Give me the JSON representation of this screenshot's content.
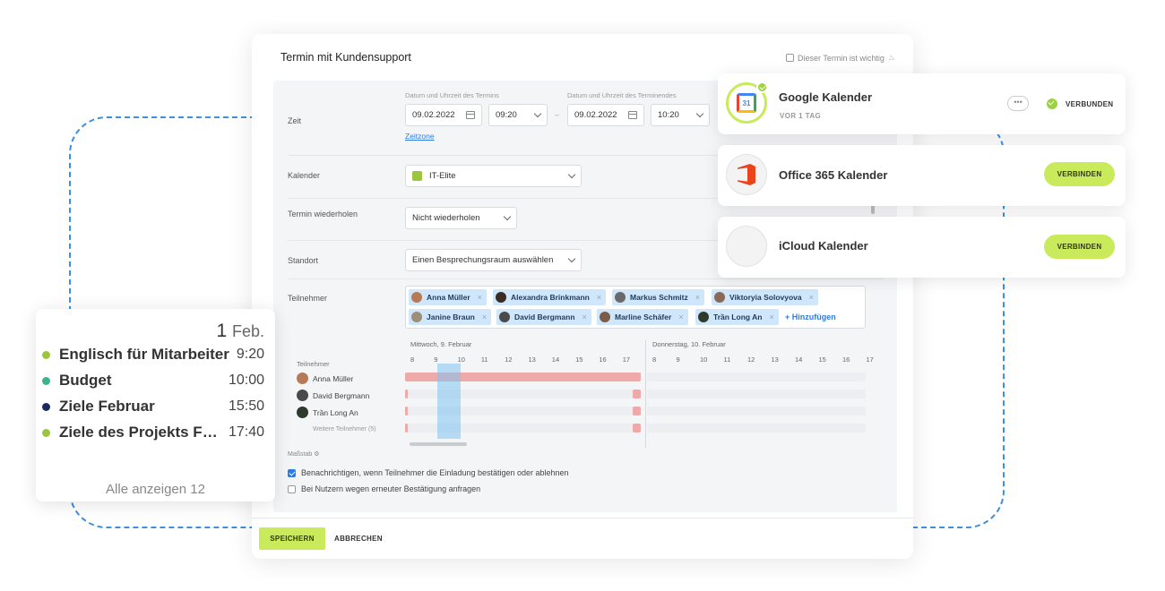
{
  "modal": {
    "title": "Termin mit Kundensupport",
    "important_label": "Dieser Termin ist wichtig",
    "time": {
      "label": "Zeit",
      "start_label": "Datum und Uhrzeit des Termins",
      "end_label": "Datum und Uhrzeit des Terminendes",
      "start_date": "09.02.2022",
      "start_time": "09:20",
      "end_date": "09.02.2022",
      "end_time": "10:20",
      "dash": "–",
      "timezone_link": "Zeitzone"
    },
    "calendar": {
      "label": "Kalender",
      "value": "IT-Elite",
      "swatch_color": "#9bc53d"
    },
    "repeat": {
      "label": "Termin wiederholen",
      "value": "Nicht wiederholen"
    },
    "location": {
      "label": "Standort",
      "value": "Einen Besprechungsraum auswählen"
    },
    "participants": {
      "label": "Teilnehmer",
      "chips": [
        "Anna Müller",
        "Alexandra Brinkmann",
        "Markus Schmitz",
        "Viktoryia Solovyova",
        "Janine Braun",
        "David Bergmann",
        "Marline Schäfer",
        "Trần Long An"
      ],
      "add_label": "+ Hinzufügen"
    },
    "timeline": {
      "participants_header": "Teilnehmer",
      "days": [
        "Mittwoch, 9. Februar",
        "Donnerstag, 10. Februar"
      ],
      "hours_day1": [
        "8",
        "9",
        "10",
        "11",
        "12",
        "13",
        "14",
        "15",
        "16",
        "17"
      ],
      "hours_day2": [
        "8",
        "9",
        "10",
        "11",
        "12",
        "13",
        "14",
        "15",
        "16",
        "17"
      ],
      "people": [
        "Anna Müller",
        "David Bergmann",
        "Trần Long An"
      ],
      "more_participants": "Weitere Teilnehmer (5)",
      "scale_label": "Maßstab"
    },
    "notify_confirm": "Benachrichtigen, wenn Teilnehmer die Einladung bestätigen oder ablehnen",
    "ask_confirm": "Bei Nutzern wegen erneuter Bestätigung anfragen",
    "save_label": "SPEICHERN",
    "cancel_label": "ABBRECHEN"
  },
  "integrations": [
    {
      "name": "Google Kalender",
      "sub": "VOR 1 TAG",
      "more": "•••",
      "status": "VERBUNDEN",
      "logo_text": "31"
    },
    {
      "name": "Office 365 Kalender",
      "action": "VERBINDEN"
    },
    {
      "name": "iCloud Kalender",
      "action": "VERBINDEN",
      "logo": ""
    }
  ],
  "agenda": {
    "day": "1",
    "month": "Feb.",
    "items": [
      {
        "title": "Englisch für Mitarbeiter",
        "time": "9:20",
        "color": "#9bc53d"
      },
      {
        "title": "Budget",
        "time": "10:00",
        "color": "#3bb48a"
      },
      {
        "title": "Ziele Februar",
        "time": "15:50",
        "color": "#1b2a5e"
      },
      {
        "title": "Ziele des Projekts Februar",
        "time": "17:40",
        "color": "#9bc53d"
      }
    ],
    "show_all": "Alle anzeigen 12"
  }
}
